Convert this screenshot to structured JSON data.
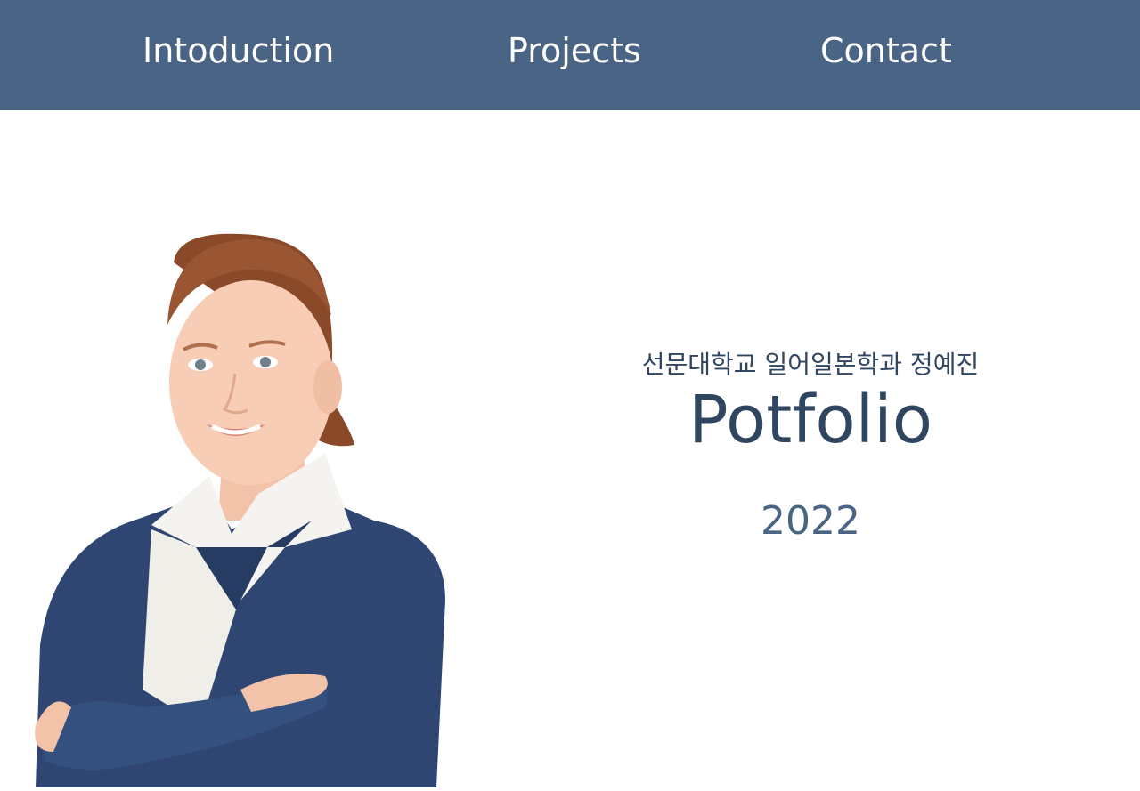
{
  "nav": {
    "items": [
      {
        "label": "Intoduction"
      },
      {
        "label": "Projects"
      },
      {
        "label": "Contact"
      }
    ]
  },
  "hero": {
    "subtitle": "선문대학교 일어일본학과 정예진",
    "title": "Potfolio",
    "year": "2022"
  },
  "colors": {
    "nav_background": "#4a6485",
    "title_text": "#2f4560",
    "year_text": "#4a6485",
    "background": "#ffffff"
  }
}
